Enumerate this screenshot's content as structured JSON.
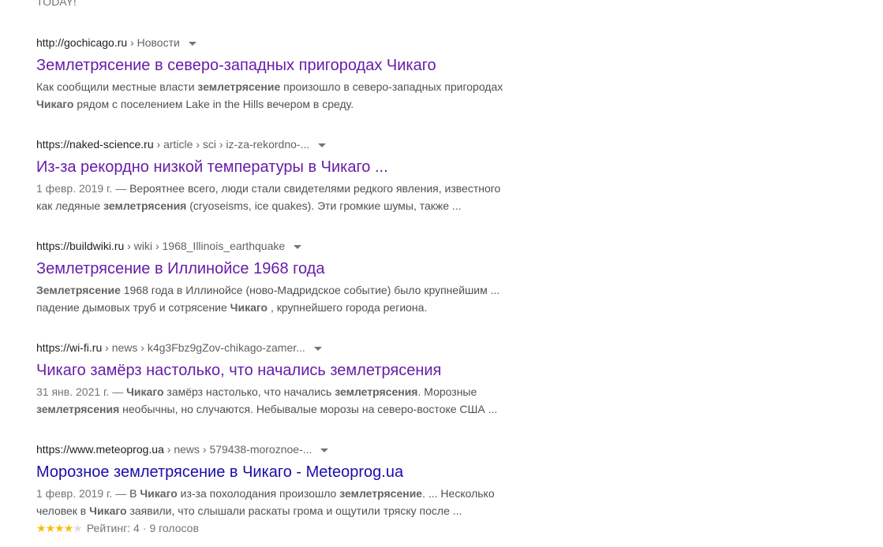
{
  "top_fragment": "TODAY!",
  "results": [
    {
      "domain": "http://gochicago.ru",
      "path": " › Новости",
      "title": "Землетрясение в северо-западных пригородах Чикаго",
      "snippet": [
        {
          "text": "Как сообщили местные власти ",
          "bold": false
        },
        {
          "text": "землетрясение",
          "bold": true
        },
        {
          "text": " произошло в северо-западных пригородах ",
          "bold": false
        },
        {
          "text": "Чикаго",
          "bold": true
        },
        {
          "text": " рядом с поселением Lake in the Hills вечером в среду.",
          "bold": false
        }
      ]
    },
    {
      "domain": "https://naked-science.ru",
      "path": " › article › sci › iz-za-rekordno-...",
      "title": "Из-за рекордно низкой температуры в Чикаго ...",
      "date": "1 февр. 2019 г. — ",
      "snippet": [
        {
          "text": "Вероятнее всего, люди стали свидетелями редкого явления, известного как ледяные ",
          "bold": false
        },
        {
          "text": "землетрясения",
          "bold": true
        },
        {
          "text": " (cryoseisms, ice quakes). Эти громкие шумы, также ...",
          "bold": false
        }
      ]
    },
    {
      "domain": "https://buildwiki.ru",
      "path": " › wiki › 1968_Illinois_earthquake",
      "title": "Землетрясение в Иллинойсе 1968 года",
      "snippet": [
        {
          "text": "Землетрясение",
          "bold": true
        },
        {
          "text": " 1968 года в Иллинойсе (ново-Мадридское событие) было крупнейшим ... падение дымовых труб и сотрясение ",
          "bold": false
        },
        {
          "text": "Чикаго",
          "bold": true
        },
        {
          "text": " , крупнейшего города региона.",
          "bold": false
        }
      ]
    },
    {
      "domain": "https://wi-fi.ru",
      "path": " › news › k4g3Fbz9gZov-chikago-zamer...",
      "title": "Чикаго замёрз настолько, что начались землетрясения",
      "date": "31 янв. 2021 г. — ",
      "snippet": [
        {
          "text": "Чикаго",
          "bold": true
        },
        {
          "text": " замёрз настолько, что начались ",
          "bold": false
        },
        {
          "text": "землетрясения",
          "bold": true
        },
        {
          "text": ". Морозные ",
          "bold": false
        },
        {
          "text": "землетрясения",
          "bold": true
        },
        {
          "text": " необычны, но случаются. Небывалые морозы на северо-востоке США ...",
          "bold": false
        }
      ]
    },
    {
      "domain": "https://www.meteoprog.ua",
      "path": " › news › 579438-moroznoe-...",
      "title": "Морозное землетрясение в Чикаго - Meteoprog.ua",
      "unvisited": true,
      "date": "1 февр. 2019 г. — ",
      "snippet": [
        {
          "text": "В ",
          "bold": false
        },
        {
          "text": "Чикаго",
          "bold": true
        },
        {
          "text": " из-за похолодания произошло ",
          "bold": false
        },
        {
          "text": "землетрясение",
          "bold": true
        },
        {
          "text": ". ... Несколько человек в ",
          "bold": false
        },
        {
          "text": "Чикаго",
          "bold": true
        },
        {
          "text": " заявили, что слышали раскаты грома и ощутили тряску после ...",
          "bold": false
        }
      ],
      "rating": {
        "stars_filled": 4,
        "stars_total": 5,
        "label": "Рейтинг: 4",
        "separator": "·",
        "votes": "9 голосов"
      }
    }
  ],
  "colors": {
    "visited_link": "#681da8",
    "unvisited_link": "#1a0dab",
    "star": "#fbbc04"
  }
}
